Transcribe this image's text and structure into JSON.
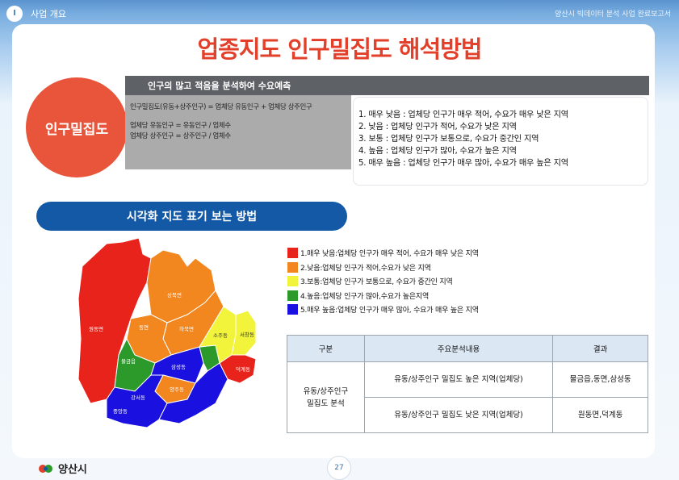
{
  "header": {
    "section_number": "I",
    "section_title": "사업 개요",
    "report_title": "양산시 빅데이터 분석 사업 완료보고서"
  },
  "page_title": "업종지도 인구밀집도 해석방법",
  "badge_label": "인구밀집도",
  "description": {
    "header": "인구의 많고 적음을 분석하여 수요예측",
    "formulas": [
      "인구밀집도(유동+상주인구) = 업체당 유동인구 + 업체당 상주인구",
      "업체당 유동인구 = 유동인구 / 업체수",
      "업체당 상주인구 = 상주인구 / 업체수"
    ],
    "levels": [
      "1. 매우 낮음 : 업체당 인구가 매우 적어, 수요가 매우 낮은 지역",
      "2. 낮음 : 업체당 인구가 적어, 수요가 낮은 지역",
      "3. 보통 : 업체당 인구가 보통으로, 수요가 중간인 지역",
      "4. 높음 : 업체당 인구가 많아, 수요가 높은 지역",
      "5. 매우 높음 : 업체당 인구가 매우 많아, 수요가 매우 높은 지역"
    ]
  },
  "map_section_title": "시각화 지도 표기 보는 방법",
  "legend": [
    {
      "label": "1.매우 낮음:업체당 인구가 매우 적어, 수요가 매우 낮은 지역",
      "color": "#e8231b"
    },
    {
      "label": "2.낮음:업체당 인구가 적어,수요가 낮은 지역",
      "color": "#f2861f"
    },
    {
      "label": "3.보통:업체당 인구가 보통으로, 수요가 중간인 지역",
      "color": "#f1f43a"
    },
    {
      "label": "4.높음:업체당 인구가 많아,수요가 높은지역",
      "color": "#2b9a2b"
    },
    {
      "label": "5.매우 높음:업체당 인구가 매우 많아, 수요가 매우 높은 지역",
      "color": "#1a10e0"
    }
  ],
  "map_labels": {
    "r1": "원동면",
    "r2": "상북면",
    "r3": "하북면",
    "r4": "동면",
    "r5": "물금읍",
    "r6": "양주동",
    "r7": "중앙동",
    "r8": "삼성동",
    "r9": "강서동",
    "r10": "서창동",
    "r11": "소주동",
    "r12": "덕계동"
  },
  "table": {
    "headers": [
      "구분",
      "주요분석내용",
      "결과"
    ],
    "category": "유동/상주인구\n밀집도 분석",
    "rows": [
      {
        "content": "유동/상주인구 밀집도 높은 지역(업체당)",
        "result": "물금읍,동면,삼성동"
      },
      {
        "content": "유동/상주인구 밀집도 낮은 지역(업체당)",
        "result": "원동면,덕계동"
      }
    ]
  },
  "footer": {
    "logo_text": "양산시",
    "page_number": "27"
  },
  "colors": {
    "title_red": "#e2402a",
    "pill_blue": "#1359a6",
    "header_gray": "#5e6166"
  }
}
